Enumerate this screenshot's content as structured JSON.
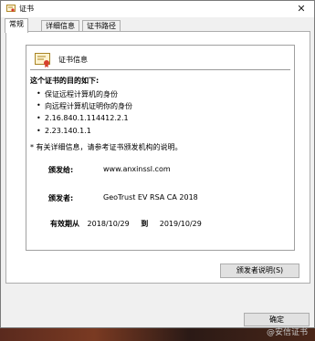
{
  "window": {
    "title": "证书",
    "close_icon": "close-icon"
  },
  "tabs": [
    {
      "label": "常规",
      "active": true
    },
    {
      "label": "详细信息",
      "active": false
    },
    {
      "label": "证书路径",
      "active": false
    }
  ],
  "cert": {
    "heading": "证书信息",
    "purpose_heading": "这个证书的目的如下:",
    "purposes": [
      "保证远程计算机的身份",
      "向远程计算机证明你的身份",
      "2.16.840.1.114412.2.1",
      "2.23.140.1.1"
    ],
    "note": "* 有关详细信息，请参考证书颁发机构的说明。",
    "issued_to_label": "颁发给:",
    "issued_to_value": "www.anxinssl.com",
    "issued_by_label": "颁发者:",
    "issued_by_value": "GeoTrust EV RSA CA 2018",
    "validity_label": "有效期从",
    "validity_from": "2018/10/29",
    "validity_to_label": "到",
    "validity_to": "2019/10/29"
  },
  "buttons": {
    "issuer_statement": "颁发者说明(S)",
    "ok": "确定"
  },
  "watermark": "@安信证书"
}
